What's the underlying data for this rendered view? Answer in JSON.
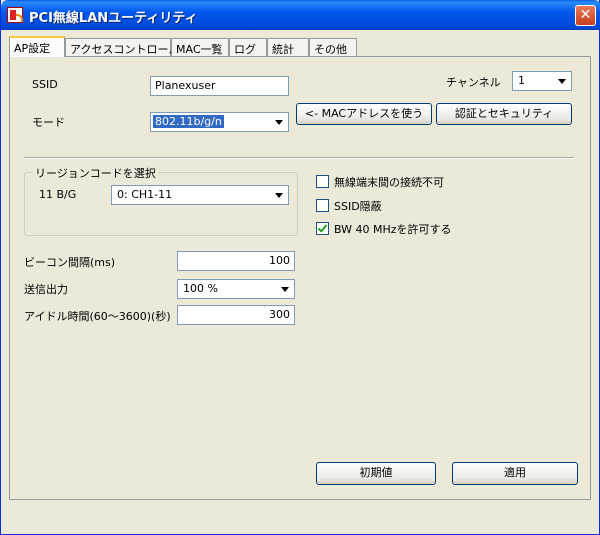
{
  "window": {
    "title": "PCI無線LANユーティリティ",
    "close_glyph": "✕"
  },
  "tabs": [
    {
      "label": "AP設定",
      "active": true
    },
    {
      "label": "アクセスコントロール",
      "active": false
    },
    {
      "label": "MAC一覧",
      "active": false
    },
    {
      "label": "ログ",
      "active": false
    },
    {
      "label": "統計",
      "active": false
    },
    {
      "label": "その他",
      "active": false
    }
  ],
  "ssid": {
    "label": "SSID",
    "value": "Planexuser"
  },
  "mode": {
    "label": "モード",
    "value": "802.11b/g/n"
  },
  "channel": {
    "label": "チャンネル",
    "value": "1"
  },
  "buttons": {
    "mac_address": "<- MACアドレスを使う",
    "auth_security": "認証とセキュリティ",
    "reset": "初期値",
    "apply": "適用"
  },
  "region": {
    "group_title": "リージョンコードを選択",
    "band_label": "11 B/G",
    "value": "0: CH1-11"
  },
  "options": [
    {
      "label": "無線端末間の接続不可",
      "checked": false
    },
    {
      "label": "SSID隠蔽",
      "checked": false
    },
    {
      "label": "BW 40 MHzを許可する",
      "checked": true
    }
  ],
  "beacon": {
    "label": "ビーコン間隔(ms)",
    "value": "100"
  },
  "tx_power": {
    "label": "送信出力",
    "value": "100 %"
  },
  "idle_time": {
    "label": "アイドル時間(60～3600)(秒)",
    "value": "300"
  }
}
